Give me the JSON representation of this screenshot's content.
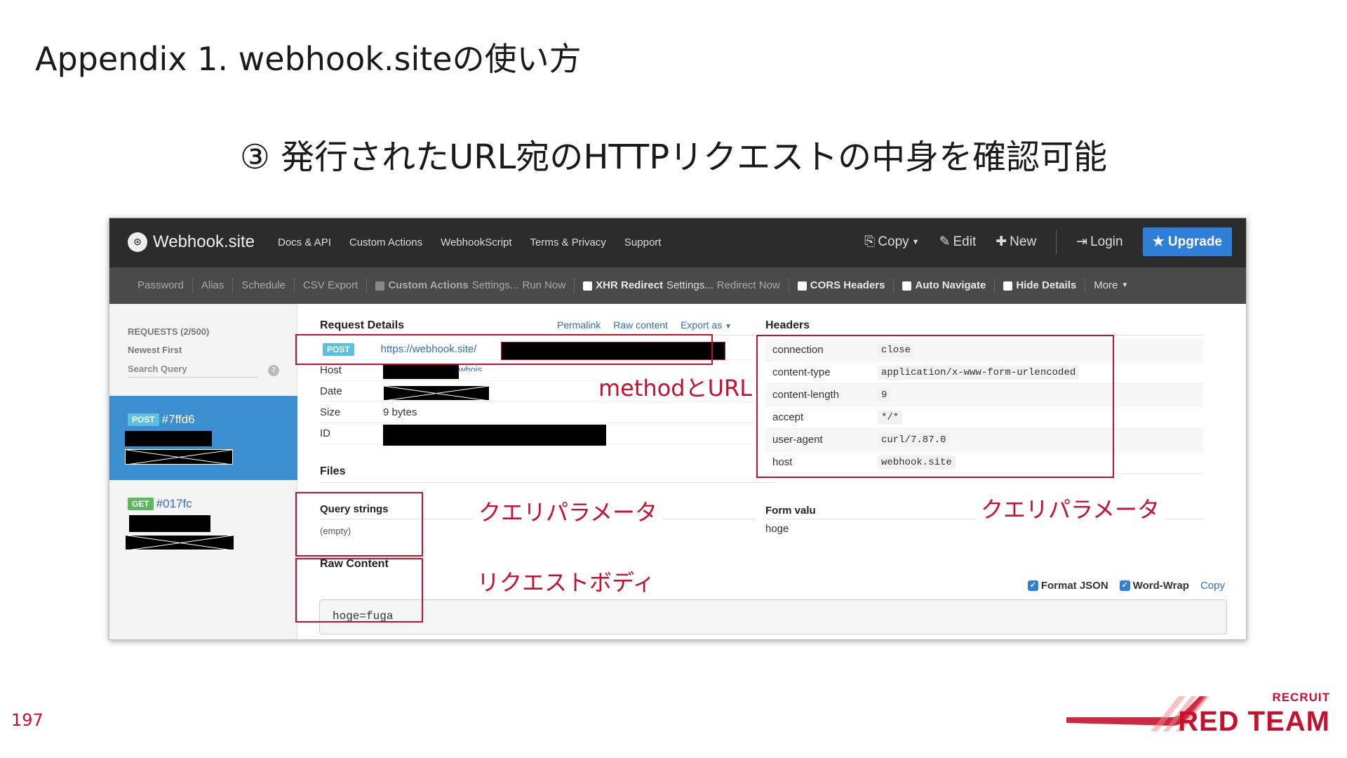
{
  "slide": {
    "title": "Appendix 1. webhook.siteの使い方",
    "subtitle": "③ 発行されたURL宛のHTTPリクエストの中身を確認可能",
    "page_number": "197",
    "logo_small": "RECRUIT",
    "logo_big": "RED TEAM"
  },
  "app": {
    "brand": "Webhook.site",
    "nav": [
      "Docs & API",
      "Custom Actions",
      "WebhookScript",
      "Terms & Privacy",
      "Support"
    ],
    "nav_right": {
      "copy": "Copy",
      "edit": "Edit",
      "new": "New",
      "login": "Login",
      "upgrade": "Upgrade"
    },
    "toolbar": {
      "password": "Password",
      "alias": "Alias",
      "schedule": "Schedule",
      "csv_export": "CSV Export",
      "custom_actions": "Custom Actions",
      "settings1": "Settings...",
      "run_now": "Run Now",
      "xhr_redirect": "XHR Redirect",
      "settings2": "Settings...",
      "redirect_now": "Redirect Now",
      "cors_headers": "CORS Headers",
      "auto_navigate": "Auto Navigate",
      "hide_details": "Hide Details",
      "more": "More"
    },
    "sidebar": {
      "requests_label": "REQUESTS (2/500)",
      "sort": "Newest First",
      "search": "Search Query",
      "help": "?",
      "items": [
        {
          "method": "POST",
          "id": "#7ffd6"
        },
        {
          "method": "GET",
          "id": "#017fc"
        }
      ]
    },
    "request_details": {
      "title": "Request Details",
      "links": [
        "Permalink",
        "Raw content",
        "Export as"
      ],
      "method": "POST",
      "url": "https://webhook.site/",
      "host_label": "Host",
      "host_suffix": "whois",
      "date_label": "Date",
      "size_label": "Size",
      "size_value": "9 bytes",
      "id_label": "ID"
    },
    "headers": {
      "title": "Headers",
      "rows": [
        {
          "k": "connection",
          "v": "close"
        },
        {
          "k": "content-type",
          "v": "application/x-www-form-urlencoded"
        },
        {
          "k": "content-length",
          "v": "9"
        },
        {
          "k": "accept",
          "v": "*/*"
        },
        {
          "k": "user-agent",
          "v": "curl/7.87.0"
        },
        {
          "k": "host",
          "v": "webhook.site"
        }
      ]
    },
    "files_title": "Files",
    "query_strings": {
      "title": "Query strings",
      "value": "(empty)"
    },
    "form_values": {
      "title": "Form valu",
      "key": "hoge"
    },
    "raw_content": {
      "title": "Raw Content",
      "value": "hoge=fuga"
    },
    "options": {
      "format_json": "Format JSON",
      "word_wrap": "Word-Wrap",
      "copy": "Copy"
    }
  },
  "annotations": {
    "method_url": "methodとURL",
    "query_param_left": "クエリパラメータ",
    "query_param_right": "クエリパラメータ",
    "request_body": "リクエストボディ"
  },
  "colors": {
    "accent": "#c8102e",
    "topbar": "#2c2c2c",
    "toolbar": "#4a4a4a",
    "active": "#3b8ed0",
    "upgrade": "#2f7ed8"
  }
}
